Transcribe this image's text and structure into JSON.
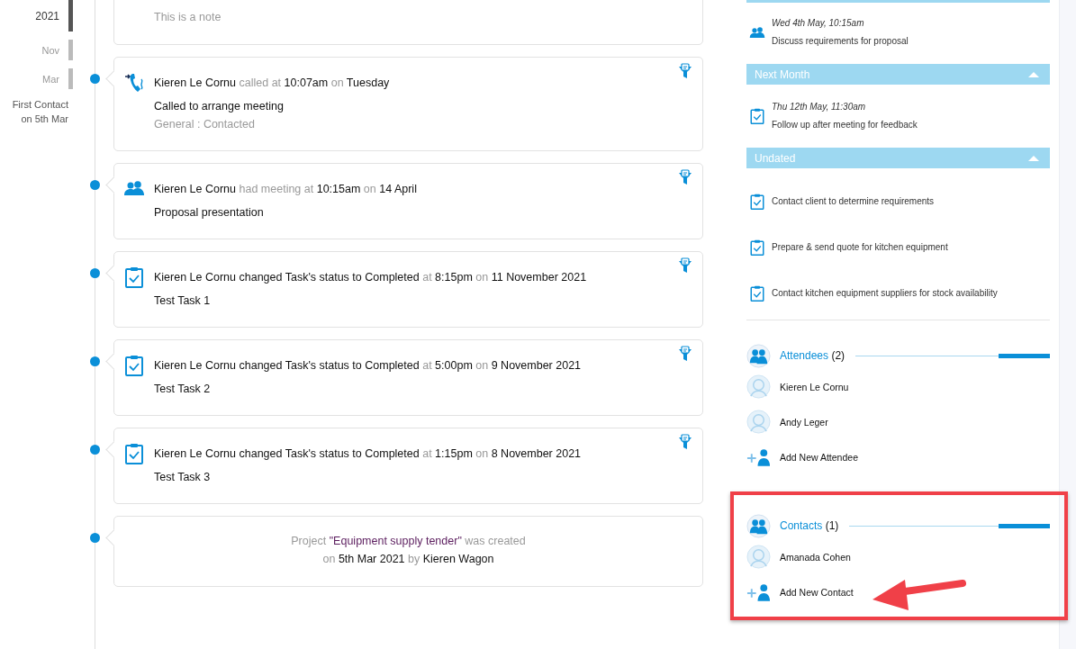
{
  "sidebar": {
    "markers": [
      {
        "label": "2021",
        "kind": "year"
      },
      {
        "label": "Nov",
        "kind": "month"
      },
      {
        "label": "Mar",
        "kind": "month"
      }
    ],
    "first_contact": "First Contact on 5th Mar"
  },
  "timeline": [
    {
      "kind": "note",
      "body": "This is a note"
    },
    {
      "kind": "call",
      "header": [
        {
          "text": "Kieren Le Cornu",
          "kind": "value"
        },
        {
          "text": "called at",
          "kind": "muted"
        },
        {
          "text": "10:07am",
          "kind": "value"
        },
        {
          "text": "on",
          "kind": "muted"
        },
        {
          "text": "Tuesday",
          "kind": "value"
        }
      ],
      "body": "Called to arrange meeting",
      "meta": "General : Contacted"
    },
    {
      "kind": "meeting",
      "header": [
        {
          "text": "Kieren Le Cornu",
          "kind": "value"
        },
        {
          "text": "had meeting at",
          "kind": "muted"
        },
        {
          "text": "10:15am",
          "kind": "value"
        },
        {
          "text": "on",
          "kind": "muted"
        },
        {
          "text": "14 April",
          "kind": "value"
        }
      ],
      "body": "Proposal presentation"
    },
    {
      "kind": "task",
      "header": [
        {
          "text": "Kieren Le Cornu changed Task's status to Completed",
          "kind": "value"
        },
        {
          "text": "at",
          "kind": "muted"
        },
        {
          "text": "8:15pm",
          "kind": "value"
        },
        {
          "text": "on",
          "kind": "muted"
        },
        {
          "text": "11 November 2021",
          "kind": "value"
        }
      ],
      "body": "Test Task 1"
    },
    {
      "kind": "task",
      "header": [
        {
          "text": "Kieren Le Cornu changed Task's status to Completed",
          "kind": "value"
        },
        {
          "text": "at",
          "kind": "muted"
        },
        {
          "text": "5:00pm",
          "kind": "value"
        },
        {
          "text": "on",
          "kind": "muted"
        },
        {
          "text": "9 November 2021",
          "kind": "value"
        }
      ],
      "body": "Test Task 2"
    },
    {
      "kind": "task",
      "header": [
        {
          "text": "Kieren Le Cornu changed Task's status to Completed",
          "kind": "value"
        },
        {
          "text": "at",
          "kind": "muted"
        },
        {
          "text": "1:15pm",
          "kind": "value"
        },
        {
          "text": "on",
          "kind": "muted"
        },
        {
          "text": "8 November 2021",
          "kind": "value"
        }
      ],
      "body": "Test Task 3"
    },
    {
      "kind": "created",
      "lines": [
        [
          {
            "text": "Project",
            "kind": "muted"
          },
          {
            "text": "\"Equipment supply tender\"",
            "kind": "link"
          },
          {
            "text": "was created",
            "kind": "muted"
          }
        ],
        [
          {
            "text": "on",
            "kind": "muted"
          },
          {
            "text": "5th Mar 2021",
            "kind": "value"
          },
          {
            "text": "by",
            "kind": "muted"
          },
          {
            "text": "Kieren Wagon",
            "kind": "value"
          }
        ]
      ]
    }
  ],
  "agenda": [
    {
      "items": [
        {
          "kind": "meeting",
          "date": "Wed 4th May, 10:15am",
          "text": "Discuss requirements for proposal"
        }
      ]
    },
    {
      "title": "Next Month",
      "expanded": true,
      "items": [
        {
          "kind": "task",
          "date": "Thu 12th May, 11:30am",
          "text": "Follow up after meeting for feedback"
        }
      ]
    },
    {
      "title": "Undated",
      "expanded": true,
      "items": [
        {
          "kind": "task",
          "text": "Contact client to determine requirements"
        },
        {
          "kind": "task",
          "text": "Prepare & send quote for kitchen equipment"
        },
        {
          "kind": "task",
          "text": "Contact kitchen equipment suppliers for stock availability"
        }
      ]
    }
  ],
  "people_sections": [
    {
      "title": "Attendees",
      "count": "(2)",
      "people": [
        "Kieren Le Cornu",
        "Andy Leger"
      ],
      "add_label": "Add New Attendee",
      "highlighted": false
    },
    {
      "title": "Contacts",
      "count": "(1)",
      "people": [
        "Amanada Cohen"
      ],
      "add_label": "Add New Contact",
      "highlighted": true
    }
  ]
}
